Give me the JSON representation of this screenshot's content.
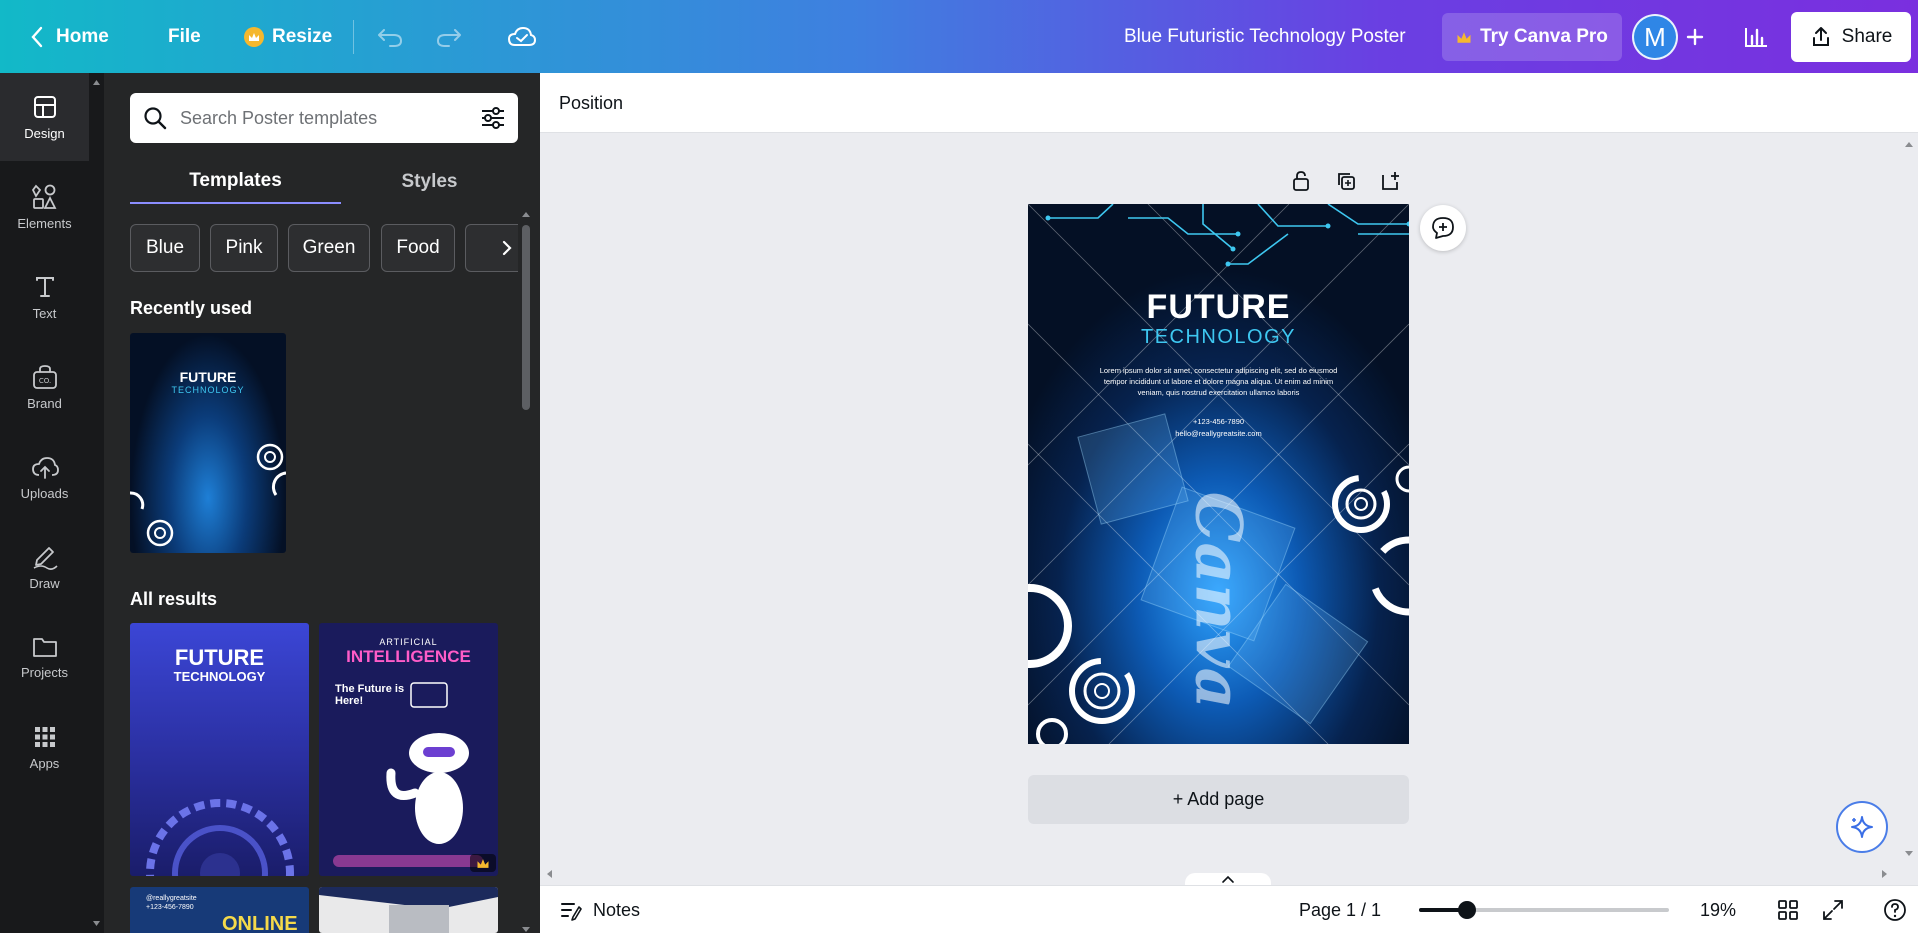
{
  "header": {
    "home_label": "Home",
    "file_label": "File",
    "resize_label": "Resize",
    "document_title": "Blue Futuristic Technology Poster",
    "try_pro_label": "Try Canva Pro",
    "avatar_initial": "M",
    "share_label": "Share"
  },
  "rail": {
    "items": [
      {
        "label": "Design",
        "icon": "layout-icon"
      },
      {
        "label": "Elements",
        "icon": "shapes-icon"
      },
      {
        "label": "Text",
        "icon": "text-icon"
      },
      {
        "label": "Brand",
        "icon": "brand-icon"
      },
      {
        "label": "Uploads",
        "icon": "cloud-upload-icon"
      },
      {
        "label": "Draw",
        "icon": "pen-icon"
      },
      {
        "label": "Projects",
        "icon": "folder-icon"
      },
      {
        "label": "Apps",
        "icon": "apps-grid-icon"
      }
    ]
  },
  "panel": {
    "search_placeholder": "Search Poster templates",
    "tabs": [
      "Templates",
      "Styles"
    ],
    "chips": [
      "Blue",
      "Pink",
      "Green",
      "Food"
    ],
    "recently_used_title": "Recently used",
    "all_results_title": "All results",
    "thumbs": {
      "recent": {
        "title": "FUTURE",
        "subtitle": "TECHNOLOGY"
      },
      "result1": {
        "title": "FUTURE",
        "subtitle": "TECHNOLOGY"
      },
      "result2": {
        "kicker": "ARTIFICIAL",
        "title": "INTELLIGENCE",
        "tagline": "The Future is Here!"
      },
      "result3": {
        "line1": "@reallygreatsite",
        "line2": "+123-456-7890",
        "headline": "ONLINE"
      }
    }
  },
  "toolbar": {
    "position_label": "Position"
  },
  "poster": {
    "title": "FUTURE",
    "subtitle": "TECHNOLOGY",
    "body": "Lorem ipsum dolor sit amet, consectetur adipiscing elit, sed do eiusmod tempor incididunt ut labore et dolore magna aliqua. Ut enim ad minim veniam, quis nostrud exercitation ullamco laboris",
    "phone": "+123-456-7890",
    "email": "hello@reallygreatsite.com",
    "watermark": "Canva"
  },
  "canvas": {
    "add_page_label": "+ Add page"
  },
  "footer": {
    "notes_label": "Notes",
    "page_indicator": "Page 1 / 1",
    "zoom_label": "19%",
    "zoom_value": 0.19
  },
  "colors": {
    "accent": "#8b3dff",
    "poster_title": "#ffffff",
    "poster_subtitle": "#3ec7f0"
  }
}
